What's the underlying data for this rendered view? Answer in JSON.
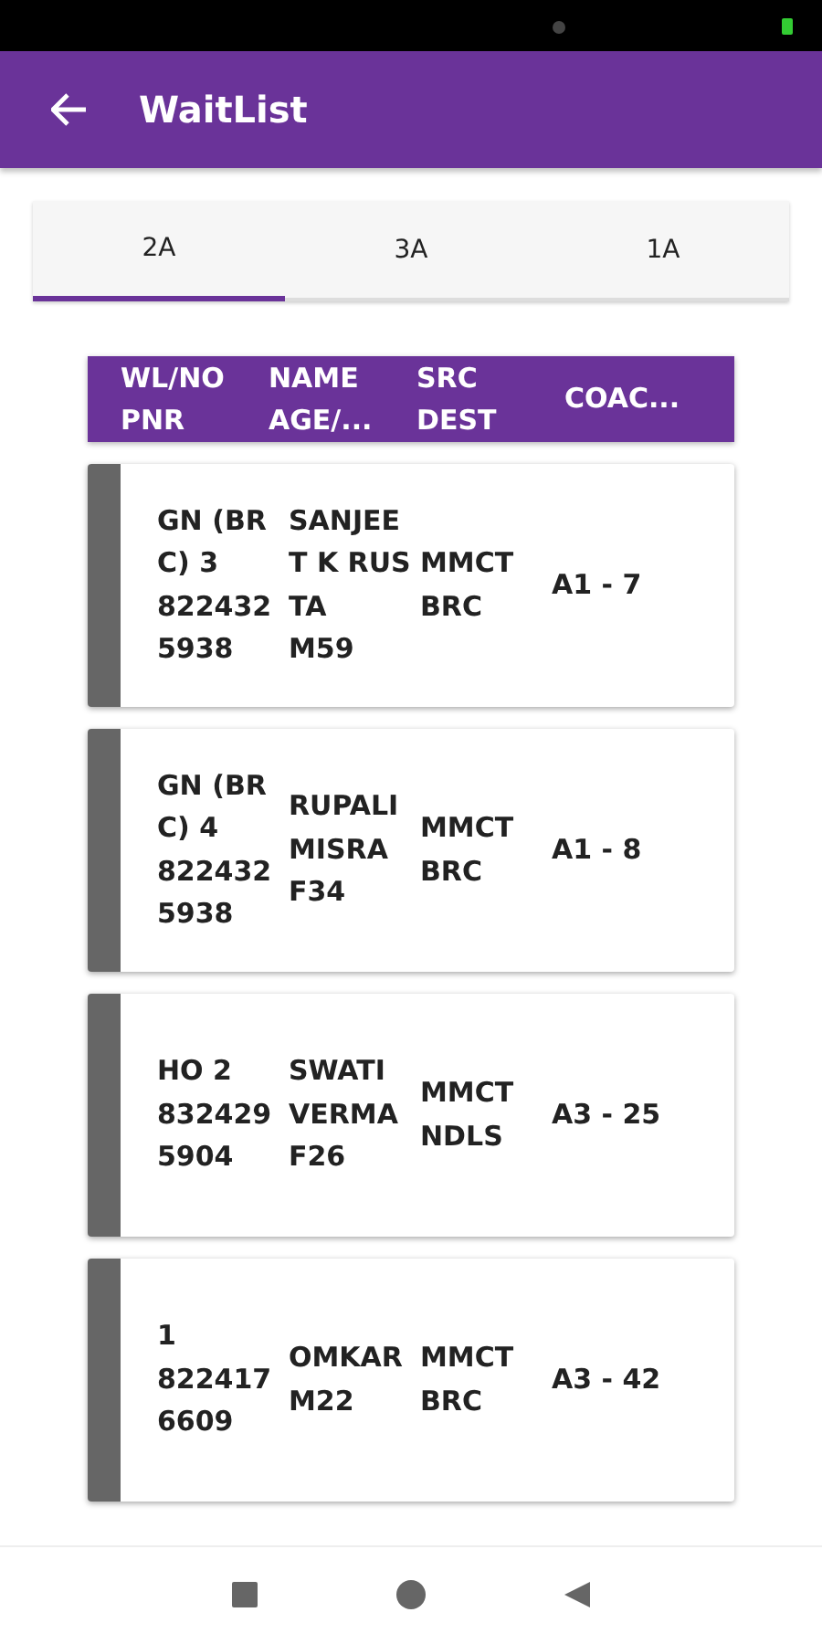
{
  "app_bar": {
    "title": "WaitList"
  },
  "tabs": [
    {
      "label": "2A",
      "selected": true
    },
    {
      "label": "3A",
      "selected": false
    },
    {
      "label": "1A",
      "selected": false
    }
  ],
  "table": {
    "columns": [
      {
        "lines": [
          "WL/NO",
          "PNR"
        ]
      },
      {
        "lines": [
          "NAME",
          "AGE/..."
        ]
      },
      {
        "lines": [
          "SRC",
          "DEST"
        ]
      },
      {
        "lines": [
          "COAC..."
        ]
      }
    ],
    "rows": [
      {
        "wl": "GN (BRC) 3",
        "pnr": "8224325938",
        "name": "SANJEET K RUSTA",
        "age": "M59",
        "src": "MMCT",
        "dest": "BRC",
        "coach": "A1 - 7"
      },
      {
        "wl": "GN (BRC) 4",
        "pnr": "8224325938",
        "name": "RUPALI MISRA",
        "age": "F34",
        "src": "MMCT",
        "dest": "BRC",
        "coach": "A1 - 8"
      },
      {
        "wl": "HO 2",
        "pnr": "8324295904",
        "name": "SWATI VERMA",
        "age": "F26",
        "src": "MMCT",
        "dest": "NDLS",
        "coach": "A3 - 25"
      },
      {
        "wl": "1",
        "pnr": "8224176609",
        "name": "OMKAR",
        "age": "M22",
        "src": "MMCT",
        "dest": "BRC",
        "coach": "A3 - 42"
      }
    ]
  }
}
